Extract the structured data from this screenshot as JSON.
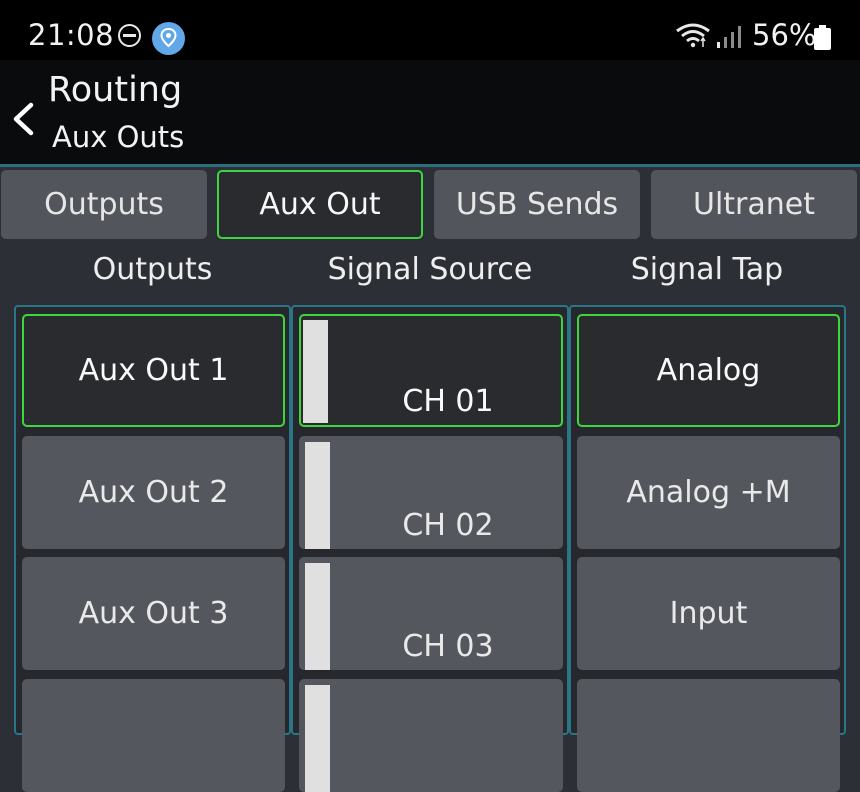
{
  "status_bar": {
    "time": "21:08",
    "battery_percent": "56%",
    "icons": [
      "do-not-disturb-icon",
      "location-icon",
      "wifi-icon",
      "signal-icon",
      "battery-icon"
    ]
  },
  "header": {
    "title": "Routing",
    "subtitle": "Aux Outs",
    "back_icon": "chevron-left-icon"
  },
  "tabs": [
    {
      "label": "Outputs",
      "active": false
    },
    {
      "label": "Aux Out",
      "active": true
    },
    {
      "label": "USB Sends",
      "active": false
    },
    {
      "label": "Ultranet",
      "active": false
    }
  ],
  "columns": {
    "outputs_header": "Outputs",
    "source_header": "Signal Source",
    "tap_header": "Signal Tap"
  },
  "rows": [
    {
      "output": "Aux Out 1",
      "source": "CH 01",
      "tap": "Analog",
      "selected": true
    },
    {
      "output": "Aux Out 2",
      "source": "CH 02",
      "tap": "Analog +M",
      "selected": false
    },
    {
      "output": "Aux Out 3",
      "source": "CH 03",
      "tap": "Input",
      "selected": false
    },
    {
      "output": "",
      "source": "",
      "tap": "",
      "selected": false
    }
  ],
  "colors": {
    "accent_green": "#3ed63e",
    "panel_border_teal": "#2a7686",
    "cell_bg": "#55575f",
    "selected_bg": "#2a2b2e"
  }
}
